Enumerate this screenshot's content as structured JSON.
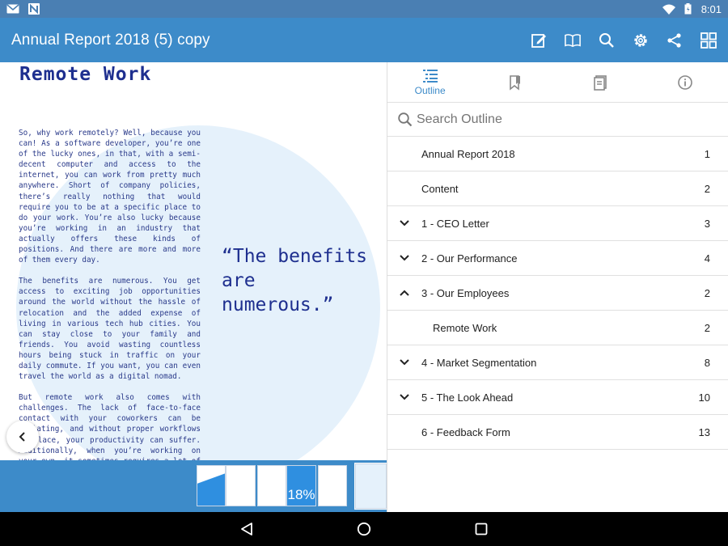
{
  "status_bar": {
    "time": "8:01"
  },
  "app_bar": {
    "title": "Annual Report 2018 (5) copy",
    "actions": [
      "edit-icon",
      "book-icon",
      "search-icon",
      "gear-icon",
      "share-icon",
      "grid-icon"
    ]
  },
  "document": {
    "heading": "Remote Work",
    "paragraphs": [
      "So, why work remotely? Well, because you can! As a software developer, you’re one of the lucky ones, in that, with a semi-decent computer and access to the internet, you can work from pretty much anywhere. Short of company policies, there’s really nothing that would require you to be at a specific place to do your work. You’re also lucky because you’re working in an industry that actually offers these kinds of positions. And there are more and more of them every day.",
      "The benefits are numerous. You get access to exciting job opportunities around the world without the hassle of relocation and the added expense of living in various tech hub cities. You can stay close to your family and friends. You avoid wasting countless hours being stuck in traffic on your daily commute. If you want, you can even travel the world as a digital nomad.",
      "But remote work also comes with challenges. The lack of face-to-face contact with your coworkers can be isolating, and without proper workflows in place, your productivity can suffer. Additionally, when you’re working on your own, it sometimes requires a lot of effort to be disciplined and/or motivated."
    ],
    "quote": "“The benefits are numerous.”"
  },
  "thumbnails": {
    "stat_label": "18%"
  },
  "panel": {
    "tabs": [
      {
        "label": "Outline",
        "icon": "list-icon",
        "active": true
      },
      {
        "label": "",
        "icon": "bookmark-icon",
        "active": false
      },
      {
        "label": "",
        "icon": "annotations-icon",
        "active": false
      },
      {
        "label": "",
        "icon": "info-icon",
        "active": false
      }
    ],
    "search_placeholder": "Search Outline",
    "outline": [
      {
        "label": "Annual Report 2018",
        "page": "1",
        "chevron": "none",
        "child": false
      },
      {
        "label": "Content",
        "page": "2",
        "chevron": "none",
        "child": false
      },
      {
        "label": "1 - CEO Letter",
        "page": "3",
        "chevron": "down",
        "child": false
      },
      {
        "label": "2 - Our Performance",
        "page": "4",
        "chevron": "down",
        "child": false
      },
      {
        "label": "3 - Our Employees",
        "page": "2",
        "chevron": "up",
        "child": false
      },
      {
        "label": "Remote Work",
        "page": "2",
        "chevron": "none",
        "child": true
      },
      {
        "label": "4 - Market Segmentation",
        "page": "8",
        "chevron": "down",
        "child": false
      },
      {
        "label": "5 - The Look Ahead",
        "page": "10",
        "chevron": "down",
        "child": false
      },
      {
        "label": "6 - Feedback Form",
        "page": "13",
        "chevron": "none",
        "child": false
      }
    ]
  }
}
